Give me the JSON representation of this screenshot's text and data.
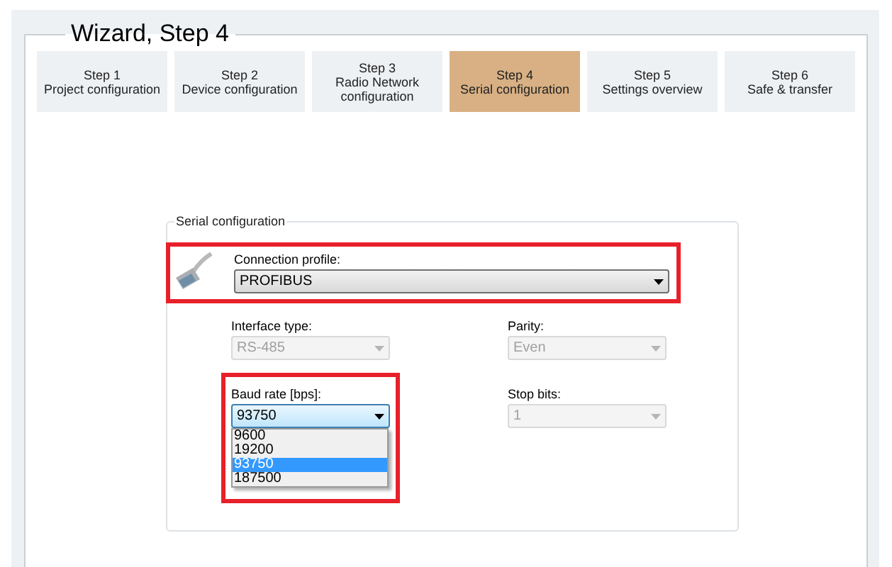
{
  "title": "Wizard, Step 4",
  "steps": [
    {
      "step": "Step 1",
      "name": "Project configuration",
      "selected": false
    },
    {
      "step": "Step 2",
      "name": "Device configuration",
      "selected": false
    },
    {
      "step": "Step 3",
      "name": "Radio Network configuration",
      "selected": false
    },
    {
      "step": "Step 4",
      "name": "Serial configuration",
      "selected": true
    },
    {
      "step": "Step 5",
      "name": "Settings overview",
      "selected": false
    },
    {
      "step": "Step 6",
      "name": "Safe & transfer",
      "selected": false
    }
  ],
  "serial_configuration": {
    "title": "Serial configuration",
    "connection_profile": {
      "label": "Connection profile:",
      "value": "PROFIBUS",
      "highlighted": true
    },
    "fields": [
      {
        "label": "Interface type:",
        "value": "RS-485",
        "disabled": true,
        "highlighted": false,
        "expanded": false
      },
      {
        "label": "Parity:",
        "value": "Even",
        "disabled": true,
        "highlighted": false,
        "expanded": false
      },
      {
        "label": "Baud rate [bps]:",
        "value": "93750",
        "disabled": false,
        "highlighted": true,
        "expanded": true,
        "options": [
          {
            "label": "9600",
            "selected": false
          },
          {
            "label": "19200",
            "selected": false
          },
          {
            "label": "93750",
            "selected": true
          },
          {
            "label": "187500",
            "selected": false
          }
        ]
      },
      {
        "label": "Stop bits:",
        "value": "1",
        "disabled": true,
        "highlighted": false,
        "expanded": false
      }
    ]
  }
}
